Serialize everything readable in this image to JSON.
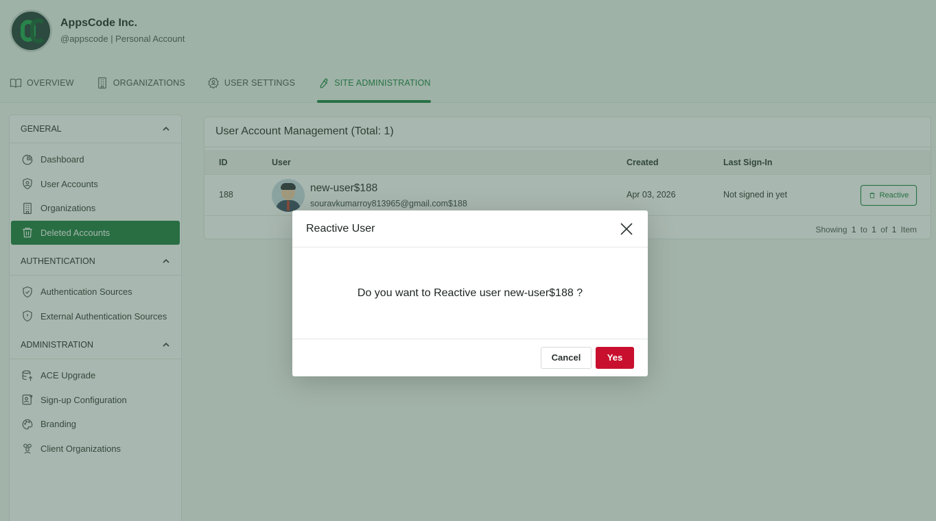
{
  "header": {
    "org_name": "AppsCode Inc.",
    "org_sub": "@appscode | Personal Account",
    "tabs": [
      {
        "label": "OVERVIEW"
      },
      {
        "label": "ORGANIZATIONS"
      },
      {
        "label": "USER SETTINGS"
      },
      {
        "label": "SITE ADMINISTRATION"
      }
    ]
  },
  "sidebar": {
    "sections": [
      {
        "title": "GENERAL",
        "items": [
          "Dashboard",
          "User Accounts",
          "Organizations",
          "Deleted Accounts"
        ]
      },
      {
        "title": "AUTHENTICATION",
        "items": [
          "Authentication Sources",
          "External Authentication Sources"
        ]
      },
      {
        "title": "ADMINISTRATION",
        "items": [
          "ACE Upgrade",
          "Sign-up Configuration",
          "Branding",
          "Client Organizations"
        ]
      }
    ]
  },
  "table": {
    "title": "User Account Management (Total: 1)",
    "columns": [
      "ID",
      "User",
      "Created",
      "Last Sign-In"
    ],
    "rows": [
      {
        "id": "188",
        "username": "new-user$188",
        "email": "souravkumarroy813965@gmail.com$188",
        "created": "Apr 03, 2026",
        "last_sign_in": "Not signed in yet",
        "action": "Reactive"
      }
    ],
    "pager": {
      "showing": "Showing",
      "from": "1",
      "to_word": "to",
      "to": "1",
      "of_word": "of",
      "total": "1",
      "unit": "Item"
    }
  },
  "modal": {
    "title": "Reactive User",
    "message": "Do you want to Reactive user new-user$188 ?",
    "cancel_label": "Cancel",
    "yes_label": "Yes"
  }
}
